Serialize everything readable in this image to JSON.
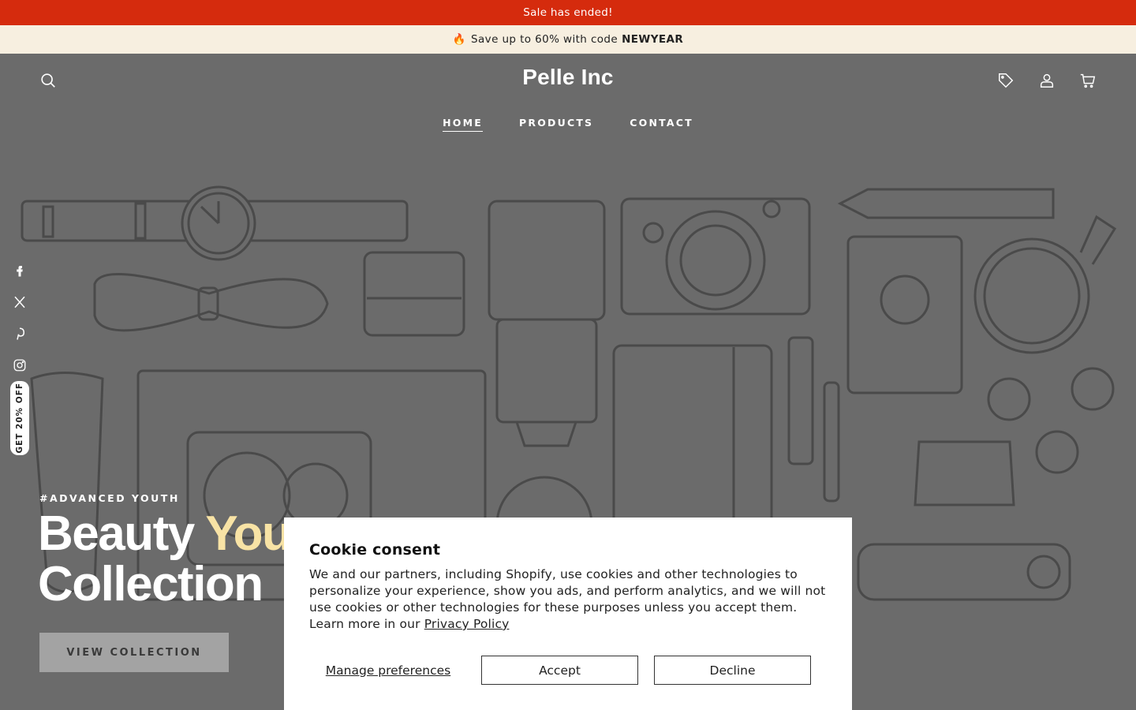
{
  "announcement": {
    "text": "Sale has ended!",
    "color": "#d52b0d"
  },
  "promo": {
    "emoji": "🔥",
    "text": "Save up to 60% with code",
    "code": "NEWYEAR"
  },
  "header": {
    "brand": "Pelle Inc",
    "icons": [
      "search-icon",
      "tag-icon",
      "account-icon",
      "cart-icon"
    ]
  },
  "nav": {
    "items": [
      "HOME",
      "PRODUCTS",
      "CONTACT"
    ],
    "active": "HOME"
  },
  "social": [
    "facebook-icon",
    "x-icon",
    "pinterest-icon",
    "instagram-icon"
  ],
  "discount_tab": {
    "label": "GET 20% OFF"
  },
  "hero": {
    "subtitle": "#ADVANCED YOUTH",
    "title_part1": "Beauty",
    "title_accent": "You",
    "title_part2": "Collection",
    "cta": "VIEW COLLECTION",
    "accent_color": "#f8e3a5"
  },
  "cookie": {
    "title": "Cookie consent",
    "body": "We and our partners, including Shopify, use cookies and other technologies to personalize your experience, show you ads, and perform analytics, and we will not use cookies or other technologies for these purposes unless you accept them. Learn more in our",
    "link": "Privacy Policy",
    "manage": "Manage preferences",
    "accept": "Accept",
    "decline": "Decline"
  }
}
